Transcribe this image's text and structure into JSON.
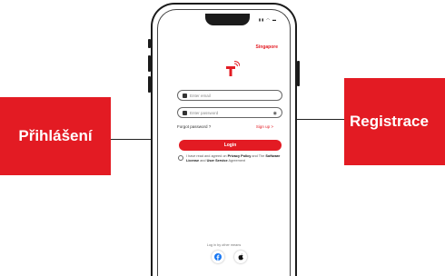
{
  "callouts": {
    "left_label": "Přihlášení",
    "right_label": "Registrace"
  },
  "status_bar": {
    "indicators": "▮▮ ◠ ▬"
  },
  "region": "Singapore",
  "login_form": {
    "email_placeholder": "Enter email",
    "password_placeholder": "Enter password",
    "forgot_password": "Forgot password ?",
    "sign_up": "Sign up >",
    "login_button": "Login",
    "agreement_prefix": "I have read and agreed on ",
    "privacy_policy": "Privacy Policy",
    "agreement_mid1": " and The ",
    "software_license": "Software License",
    "agreement_mid2": " and ",
    "user_service": "User Service",
    "agreement_suffix": " Agreement",
    "other_login": "Log in by other means"
  },
  "icons": {
    "user": "user-icon",
    "lock": "lock-icon",
    "eye": "eye-icon",
    "facebook": "facebook-icon",
    "apple": "apple-icon"
  },
  "colors": {
    "accent": "#e31b23"
  }
}
